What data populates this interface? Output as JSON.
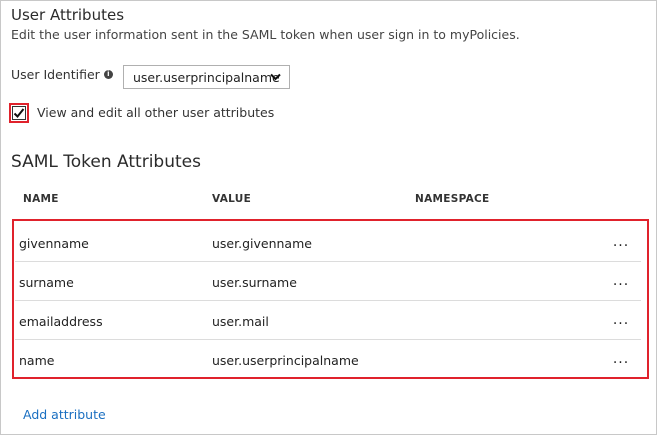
{
  "section": {
    "title": "User Attributes",
    "description": "Edit the user information sent in the SAML token when user sign in to myPolicies."
  },
  "user_identifier": {
    "label": "User Identifier",
    "info_icon": "info-icon",
    "value": "user.userprincipalname"
  },
  "view_all_checkbox": {
    "checked": true,
    "label": "View and edit all other user attributes"
  },
  "saml": {
    "title": "SAML Token Attributes",
    "columns": [
      "NAME",
      "VALUE",
      "NAMESPACE"
    ],
    "rows": [
      {
        "name": "givenname",
        "value": "user.givenname",
        "namespace": "",
        "menu": "..."
      },
      {
        "name": "surname",
        "value": "user.surname",
        "namespace": "",
        "menu": "..."
      },
      {
        "name": "emailaddress",
        "value": "user.mail",
        "namespace": "",
        "menu": "..."
      },
      {
        "name": "name",
        "value": "user.userprincipalname",
        "namespace": "",
        "menu": "..."
      }
    ]
  },
  "add_attribute_label": "Add attribute",
  "colors": {
    "highlight": "#e0222c",
    "link": "#1a6fc1"
  }
}
